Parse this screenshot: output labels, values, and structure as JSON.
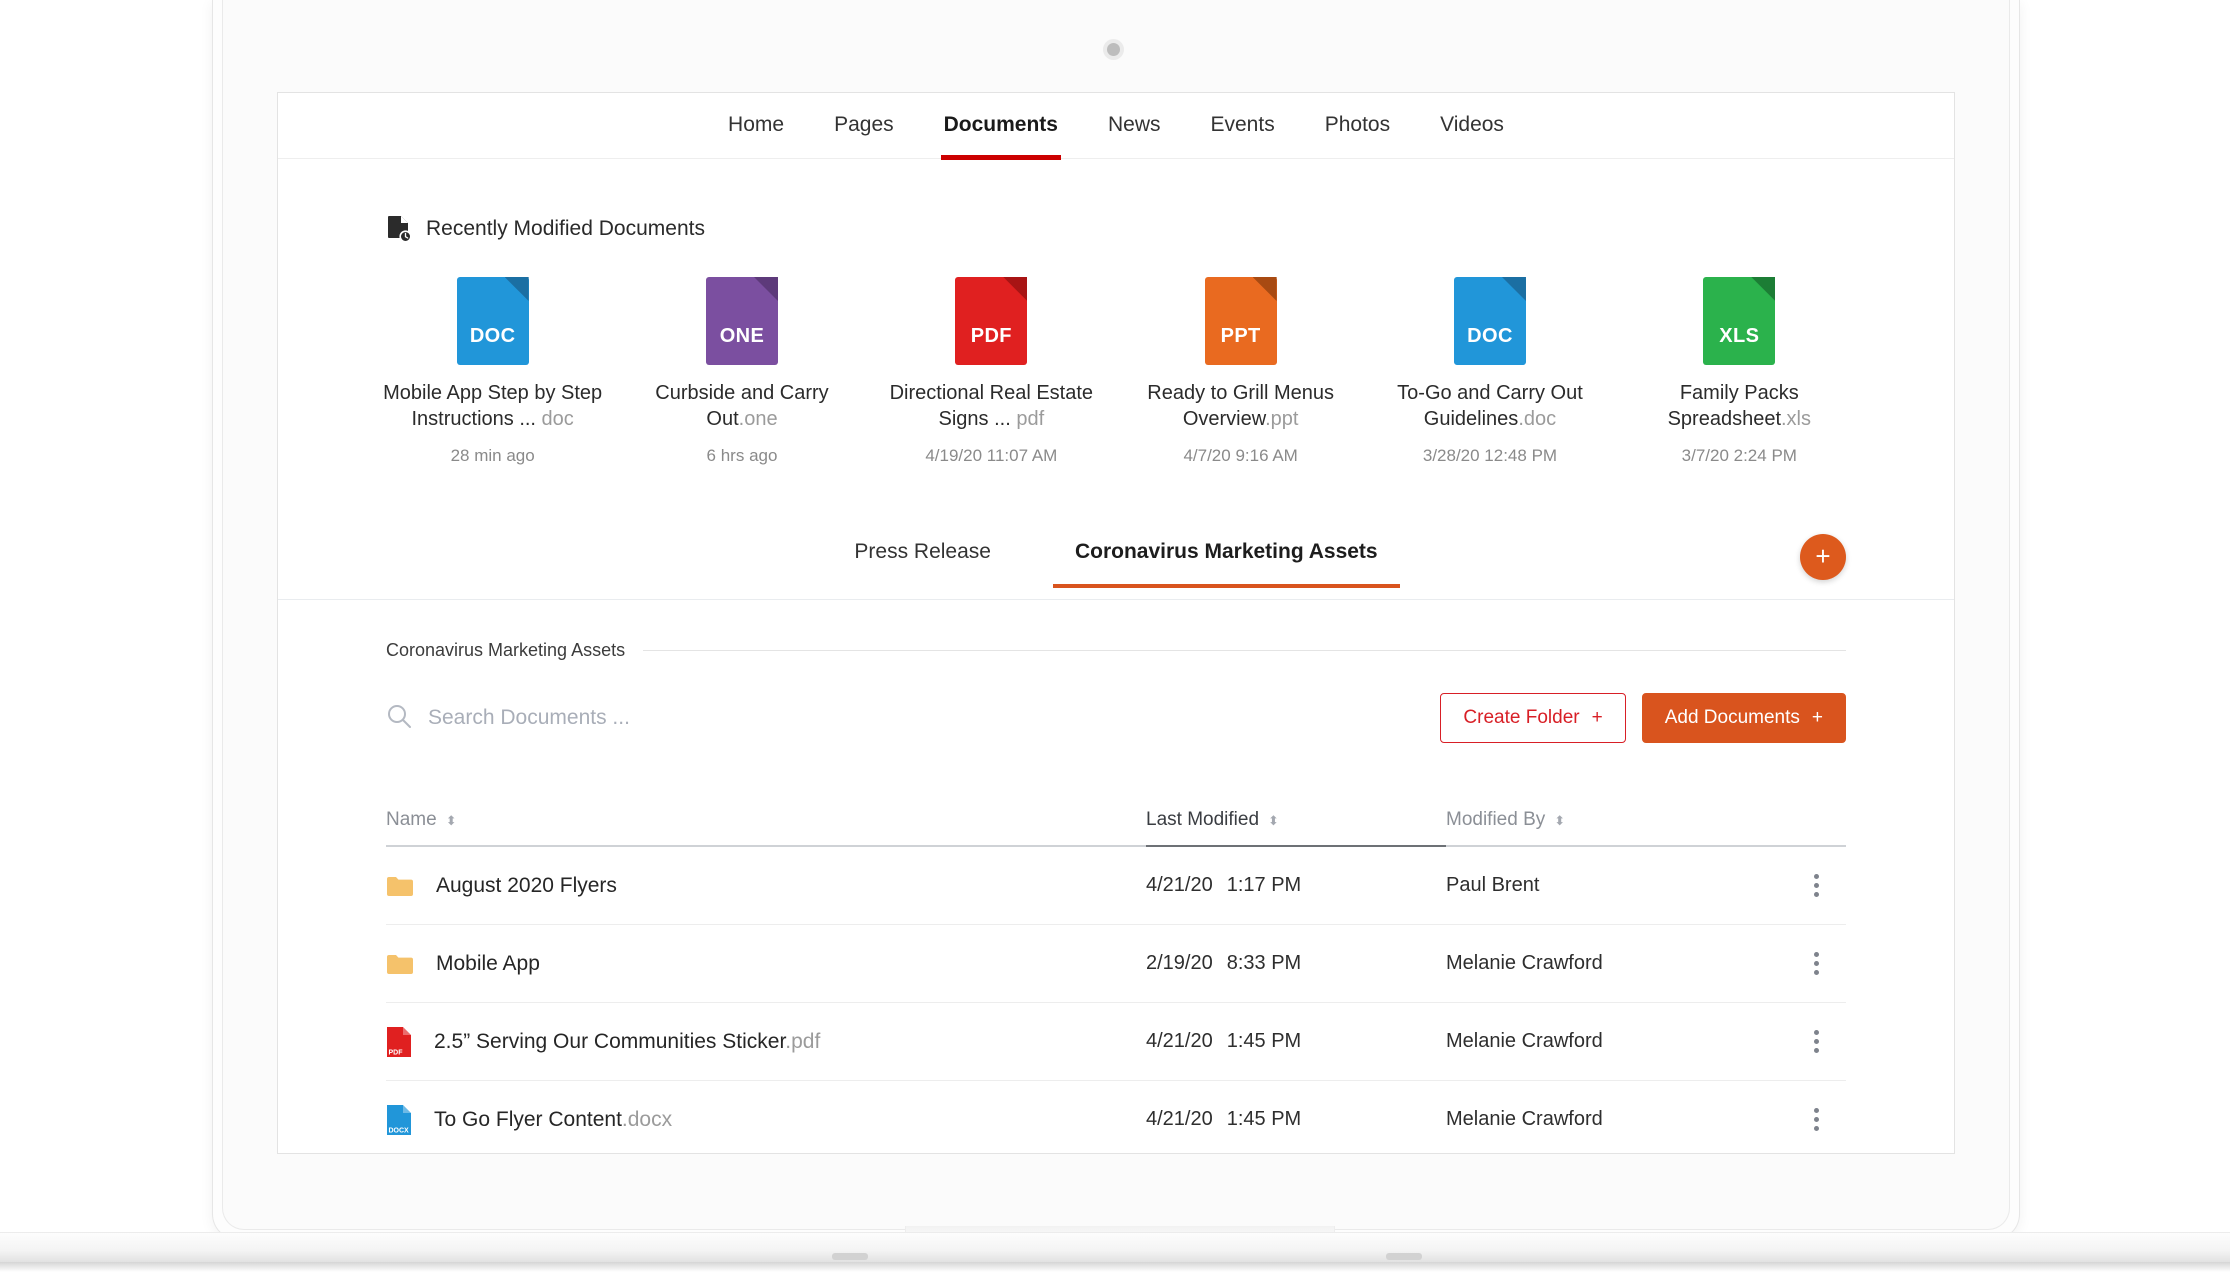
{
  "top_nav": {
    "items": [
      {
        "label": "Home",
        "active": false
      },
      {
        "label": "Pages",
        "active": false
      },
      {
        "label": "Documents",
        "active": true
      },
      {
        "label": "News",
        "active": false
      },
      {
        "label": "Events",
        "active": false
      },
      {
        "label": "Photos",
        "active": false
      },
      {
        "label": "Videos",
        "active": false
      }
    ],
    "active_underline_color": "#cc0000"
  },
  "recent": {
    "heading": "Recently Modified Documents",
    "heading_icon": "document-clock-icon",
    "cards": [
      {
        "ext_label": "DOC",
        "color": "#2196d9",
        "corner_color": "#1b6fa3",
        "name": "Mobile App Step by Step Instructions ...",
        "suffix": " doc",
        "time": "28 min ago"
      },
      {
        "ext_label": "ONE",
        "color": "#7b4fa0",
        "corner_color": "#5d3a7a",
        "name": "Curbside and Carry Out",
        "suffix": ".one",
        "time": "6 hrs ago"
      },
      {
        "ext_label": "PDF",
        "color": "#e02020",
        "corner_color": "#a81414",
        "name": "Directional Real Estate Signs ...",
        "suffix": " pdf",
        "time": "4/19/20  11:07 AM"
      },
      {
        "ext_label": "PPT",
        "color": "#e96a20",
        "corner_color": "#a84a12",
        "name": "Ready to Grill Menus Overview",
        "suffix": ".ppt",
        "time": "4/7/20  9:16 AM"
      },
      {
        "ext_label": "DOC",
        "color": "#2196d9",
        "corner_color": "#1b6fa3",
        "name": "To-Go and Carry Out Guidelines",
        "suffix": ".doc",
        "time": "3/28/20  12:48 PM"
      },
      {
        "ext_label": "XLS",
        "color": "#2bb24c",
        "corner_color": "#1c7d35",
        "name": "Family Packs Spreadsheet",
        "suffix": ".xls",
        "time": "3/7/20  2:24 PM"
      }
    ]
  },
  "library_tabs": {
    "items": [
      {
        "label": "Press Release",
        "active": false
      },
      {
        "label": "Coronavirus Marketing Assets",
        "active": true
      }
    ],
    "active_underline_color": "#d9541e",
    "add_button_label": "+"
  },
  "library": {
    "breadcrumb": "Coronavirus Marketing Assets",
    "search_placeholder": "Search Documents ...",
    "search_value": "",
    "create_folder_label": "Create Folder",
    "create_folder_plus": "+",
    "create_folder_color": "#d81f26",
    "add_documents_label": "Add Documents",
    "add_documents_plus": "+",
    "add_documents_color": "#d9541e"
  },
  "table": {
    "headers": [
      {
        "label": "Name",
        "sorted": false
      },
      {
        "label": "Last Modified",
        "sorted": true
      },
      {
        "label": "Modified By",
        "sorted": false
      }
    ],
    "sort_glyph": "⬍",
    "rows": [
      {
        "icon": "folder-icon",
        "icon_kind": "folder",
        "name": "August 2020 Flyers",
        "suffix": "",
        "date": "4/21/20",
        "time": "1:17 PM",
        "modified_by": "Paul Brent",
        "menu_icon": "kebab-menu-icon"
      },
      {
        "icon": "folder-icon",
        "icon_kind": "folder",
        "name": "Mobile App",
        "suffix": "",
        "date": "2/19/20",
        "time": "8:33 PM",
        "modified_by": "Melanie Crawford",
        "menu_icon": "kebab-menu-icon"
      },
      {
        "icon": "pdf-file-icon",
        "icon_kind": "pdf",
        "icon_color": "#e02020",
        "icon_label": "PDF",
        "name": "2.5” Serving Our Communities Sticker",
        "suffix": ".pdf",
        "date": "4/21/20",
        "time": "1:45 PM",
        "modified_by": "Melanie Crawford",
        "menu_icon": "kebab-menu-icon"
      },
      {
        "icon": "docx-file-icon",
        "icon_kind": "docx",
        "icon_color": "#2196d9",
        "icon_label": "DOCX",
        "name": "To Go Flyer Content",
        "suffix": ".docx",
        "date": "4/21/20",
        "time": "1:45 PM",
        "modified_by": "Melanie Crawford",
        "menu_icon": "kebab-menu-icon"
      }
    ]
  }
}
